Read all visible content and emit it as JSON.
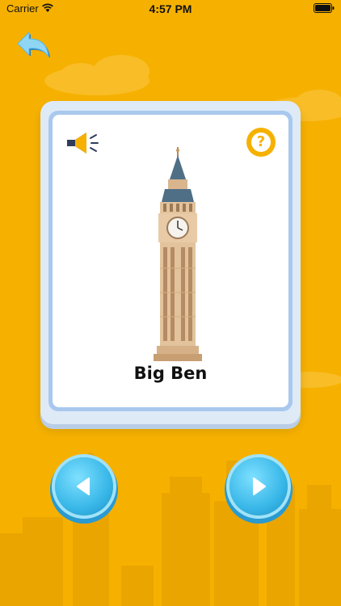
{
  "status_bar": {
    "carrier": "Carrier",
    "time": "4:57 PM",
    "wifi_icon": "wifi-icon",
    "battery_icon": "battery-icon"
  },
  "header": {
    "back_icon": "back-arrow-icon"
  },
  "card": {
    "word": "Big Ben",
    "speaker_icon": "speaker-icon",
    "hint_label": "?",
    "image": "big-ben-illustration"
  },
  "navigation": {
    "previous_icon": "triangle-left-icon",
    "next_icon": "triangle-right-icon"
  },
  "colors": {
    "background": "#f6b100",
    "card_border": "#a9c8ee",
    "nav_button": "#38b7e8"
  }
}
